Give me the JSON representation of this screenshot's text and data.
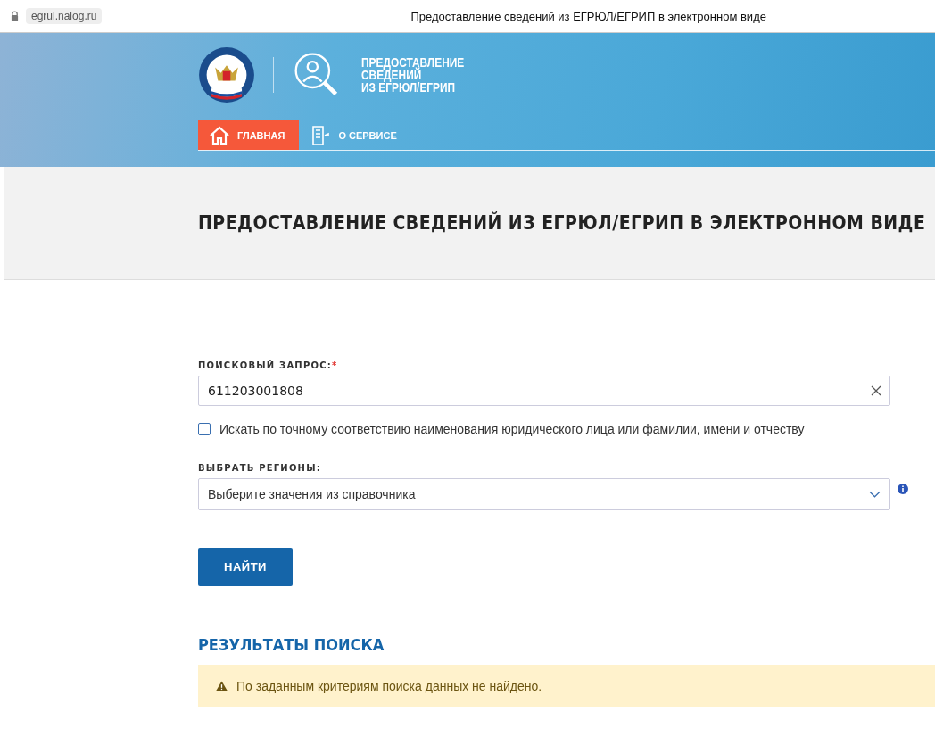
{
  "browser": {
    "address": "egrul.nalog.ru",
    "title": "Предоставление сведений из ЕГРЮЛ/ЕГРИП в электронном виде"
  },
  "header": {
    "service_title": [
      "ПРЕДОСТАВЛЕНИЕ",
      "СВЕДЕНИЙ",
      "ИЗ ЕГРЮЛ/ЕГРИП"
    ]
  },
  "nav": [
    {
      "label": "ГЛАВНАЯ",
      "kind": "home",
      "selected": true
    },
    {
      "label": "О СЕРВИСЕ",
      "kind": "document",
      "selected": false
    }
  ],
  "page_title": "ПРЕДОСТАВЛЕНИЕ СВЕДЕНИЙ ИЗ ЕГРЮЛ/ЕГРИП В ЭЛЕКТРОННОМ ВИДЕ",
  "form": {
    "query_label": "ПОИСКОВЫЙ ЗАПРОС:",
    "required_mark": "*",
    "query_value": "611203001808",
    "exact_match": {
      "label": "Искать по точному соответствию наименования юридического лица или фамилии, имени и отчеству",
      "checked": false
    },
    "regions_label": "ВЫБРАТЬ РЕГИОНЫ:",
    "regions_placeholder": "Выберите значения из справочника",
    "submit": "НАЙТИ"
  },
  "results": {
    "title": "РЕЗУЛЬТАТЫ ПОИСКА",
    "message": "По заданным критериям поиска данных не найдено."
  }
}
